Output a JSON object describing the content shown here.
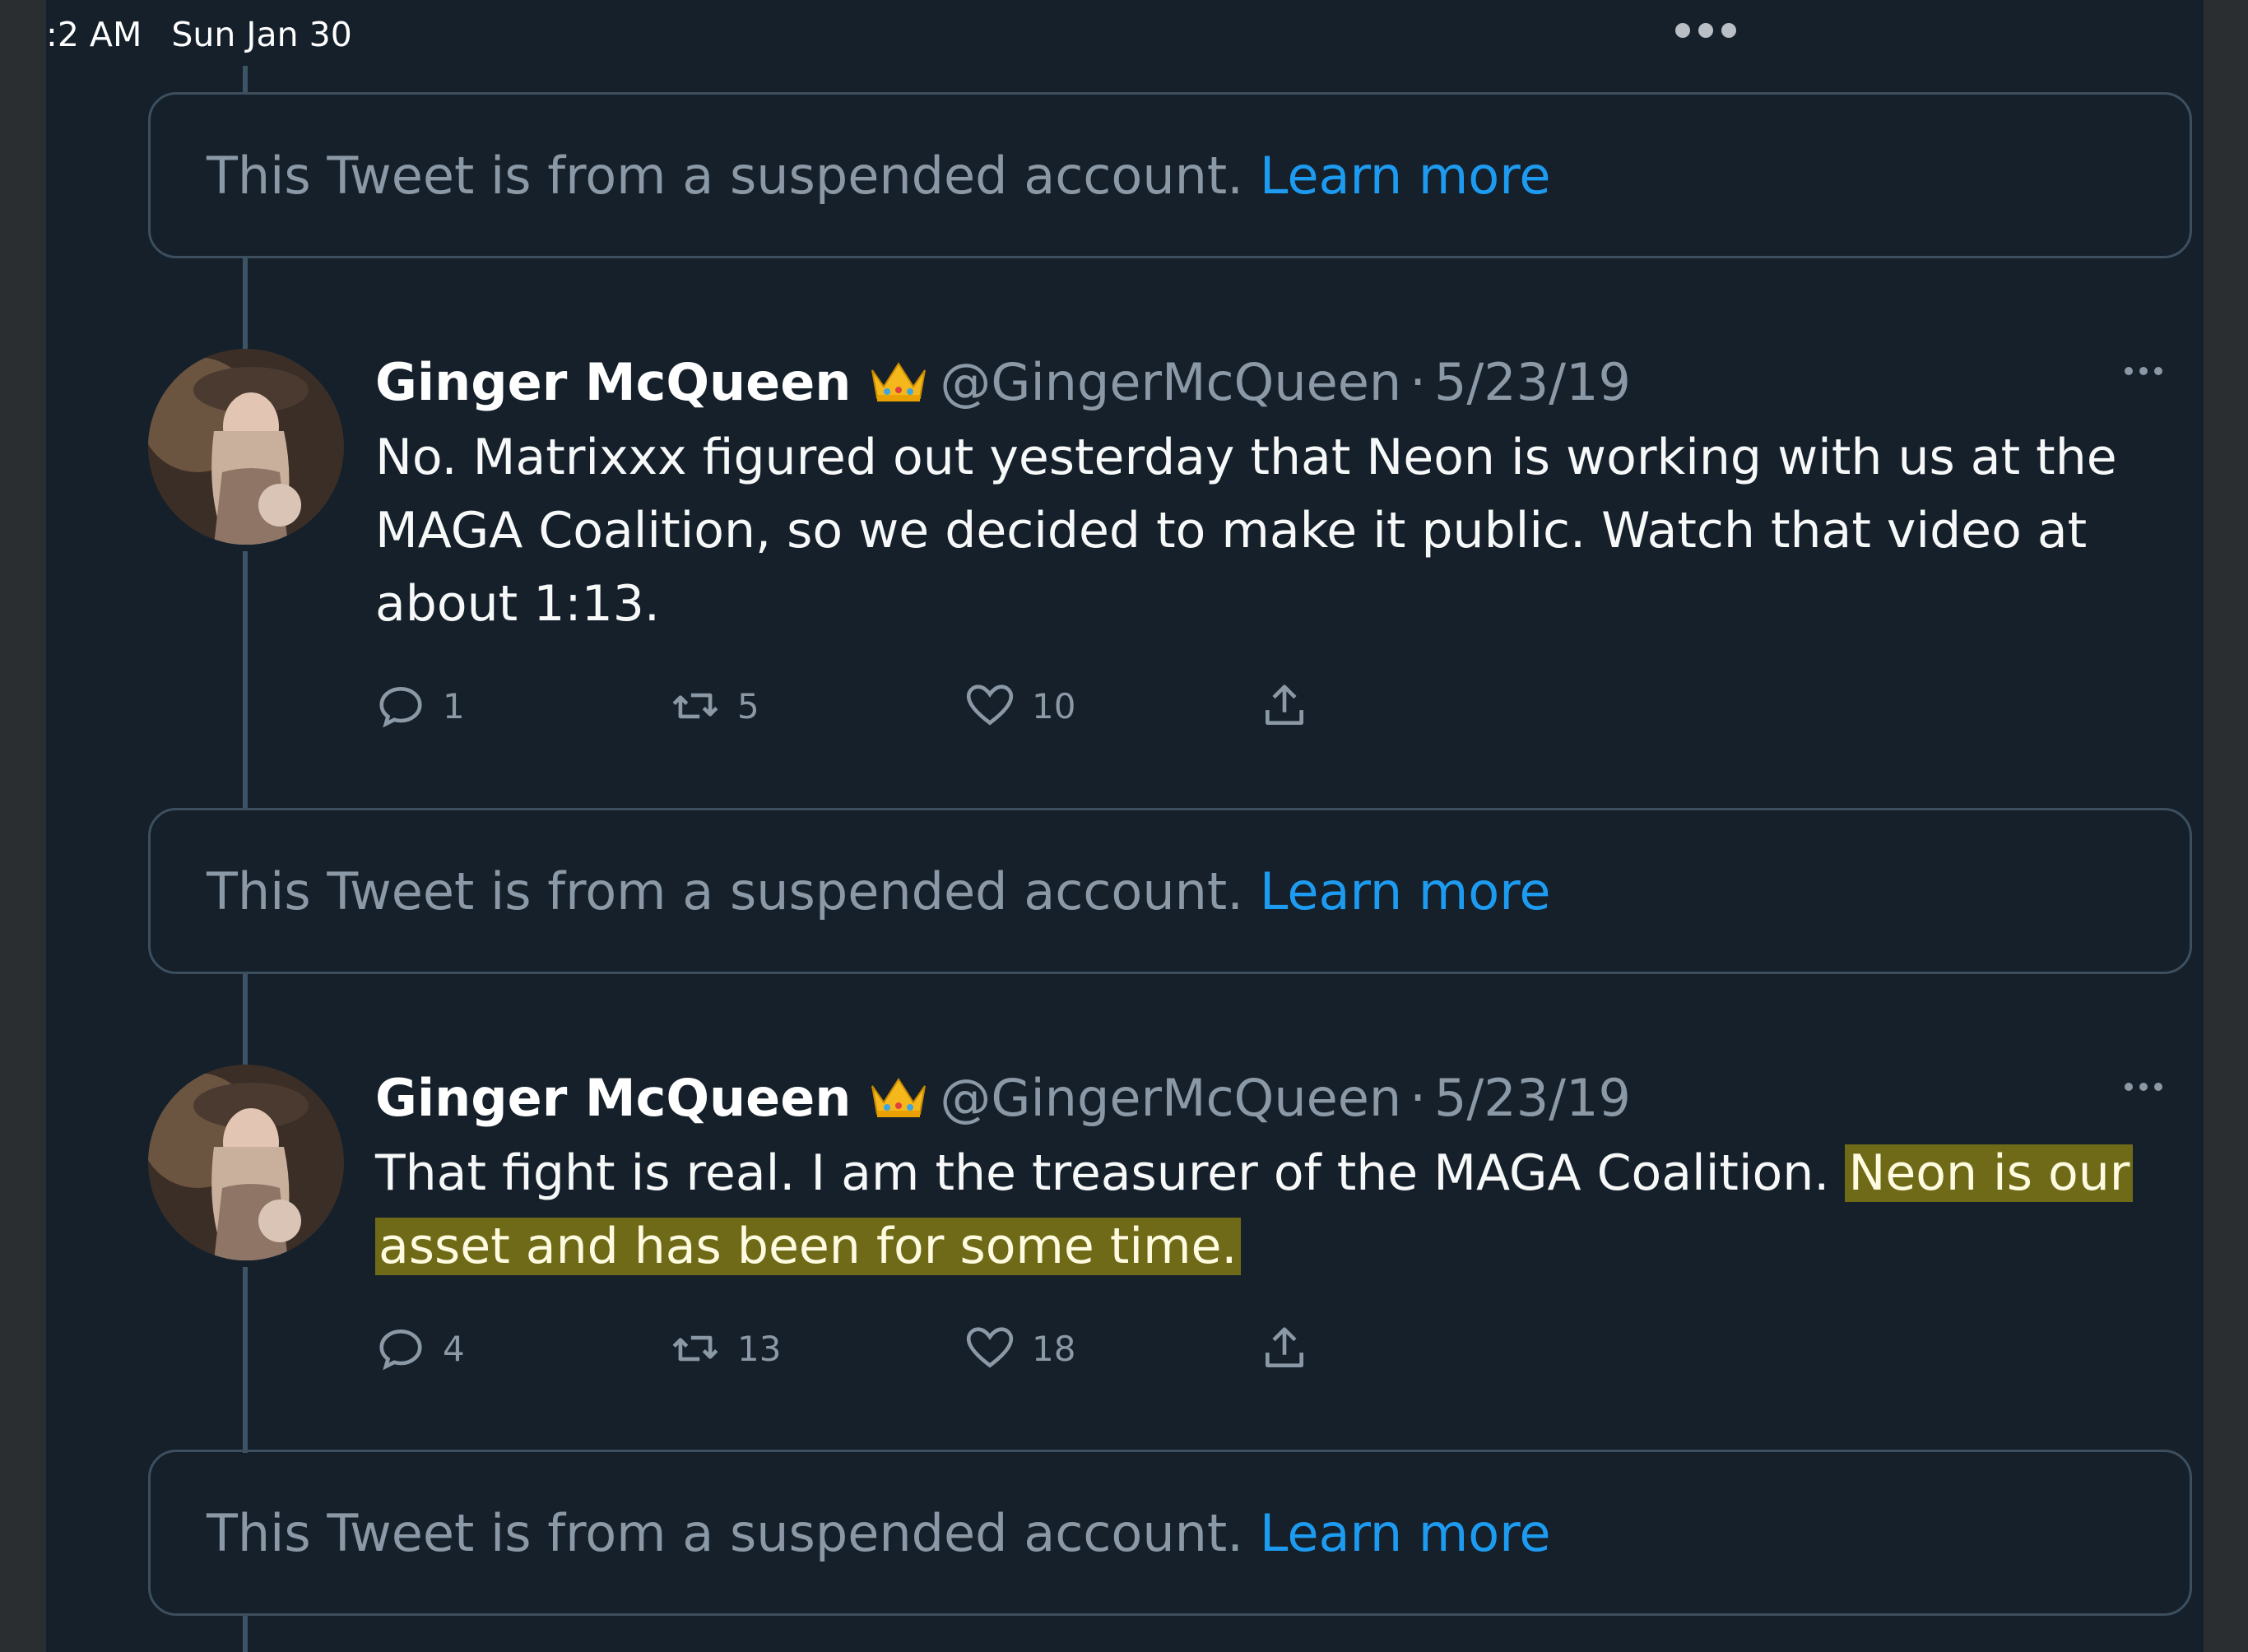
{
  "status_bar": {
    "time": ":2 AM",
    "date": "Sun Jan 30"
  },
  "suspended_notice": {
    "text": "This Tweet is from a suspended account.",
    "link": "Learn more"
  },
  "tweets": [
    {
      "author": "Ginger McQueen",
      "emoji": "crown",
      "handle": "@GingerMcQueen",
      "separator": "·",
      "date": "5/23/19",
      "text": "No. Matrixxx figured out yesterday that Neon is working with us at the MAGA Coalition, so we decided to make it public. Watch that video at about 1:13.",
      "replies": "1",
      "retweets": "5",
      "likes": "10"
    },
    {
      "author": "Ginger McQueen",
      "emoji": "crown",
      "handle": "@GingerMcQueen",
      "separator": "·",
      "date": "5/23/19",
      "text_plain": "That fight is real. I am the treasurer of the MAGA Coalition. ",
      "text_highlighted": "Neon is our asset and has been for some time.",
      "highlight_color": "#6f6a17",
      "replies": "4",
      "retweets": "13",
      "likes": "18"
    }
  ],
  "colors": {
    "background": "#15202b",
    "link": "#1d9bf0",
    "muted": "#8b98a5",
    "border": "#3d4f5f"
  }
}
